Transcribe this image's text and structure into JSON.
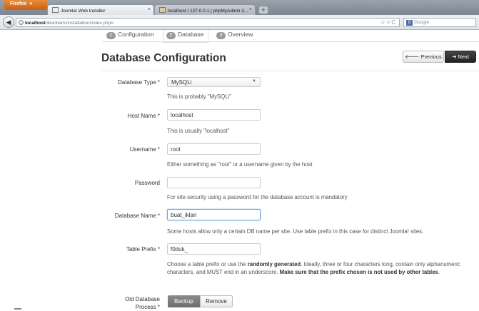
{
  "browser": {
    "firefox_button": "Firefox",
    "tabs": [
      {
        "title": "Joomla! Web Installer",
        "active": true
      },
      {
        "title": "localhost / 127.0.0.1 | phpMyAdmin 3...",
        "active": false
      }
    ],
    "new_tab": "+",
    "url_host": "localhost",
    "url_path": "/iklanbaris/installation/index.php#",
    "search_placeholder": "Google"
  },
  "steps": [
    {
      "num": "1",
      "label": "Configuration"
    },
    {
      "num": "2",
      "label": "Database"
    },
    {
      "num": "3",
      "label": "Overview"
    }
  ],
  "page": {
    "title": "Database Configuration",
    "previous_label": "Previous",
    "next_label": "Next"
  },
  "form": {
    "db_type": {
      "label": "Database Type *",
      "value": "MySQLi",
      "help": "This is probably \"MySQLi\""
    },
    "host": {
      "label": "Host Name *",
      "value": "localhost",
      "help": "This is usually \"localhost\""
    },
    "username": {
      "label": "Username *",
      "value": "root",
      "help": "Either something as \"root\" or a username given by the host"
    },
    "password": {
      "label": "Password",
      "value": "",
      "help": "For site security using a password for the database account is mandatory"
    },
    "db_name": {
      "label": "Database Name *",
      "value": "buat_iklan",
      "help": "Some hosts allow only a certain DB name per site. Use table prefix in this case for distinct Joomla! sites."
    },
    "prefix": {
      "label": "Table Prefix *",
      "value": "f0duk_",
      "help_1": "Choose a table prefix or use the ",
      "help_bold_1": "randomly generated",
      "help_2": ". Ideally, three or four characters long, contain only alphanumeric characters, and MUST end in an underscore. ",
      "help_bold_2": "Make sure that the prefix chosen is not used by other tables",
      "help_3": "."
    },
    "old_db": {
      "label_1": "Old Database",
      "label_2": "Process *",
      "backup_label": "Backup",
      "remove_label": "Remove"
    }
  }
}
